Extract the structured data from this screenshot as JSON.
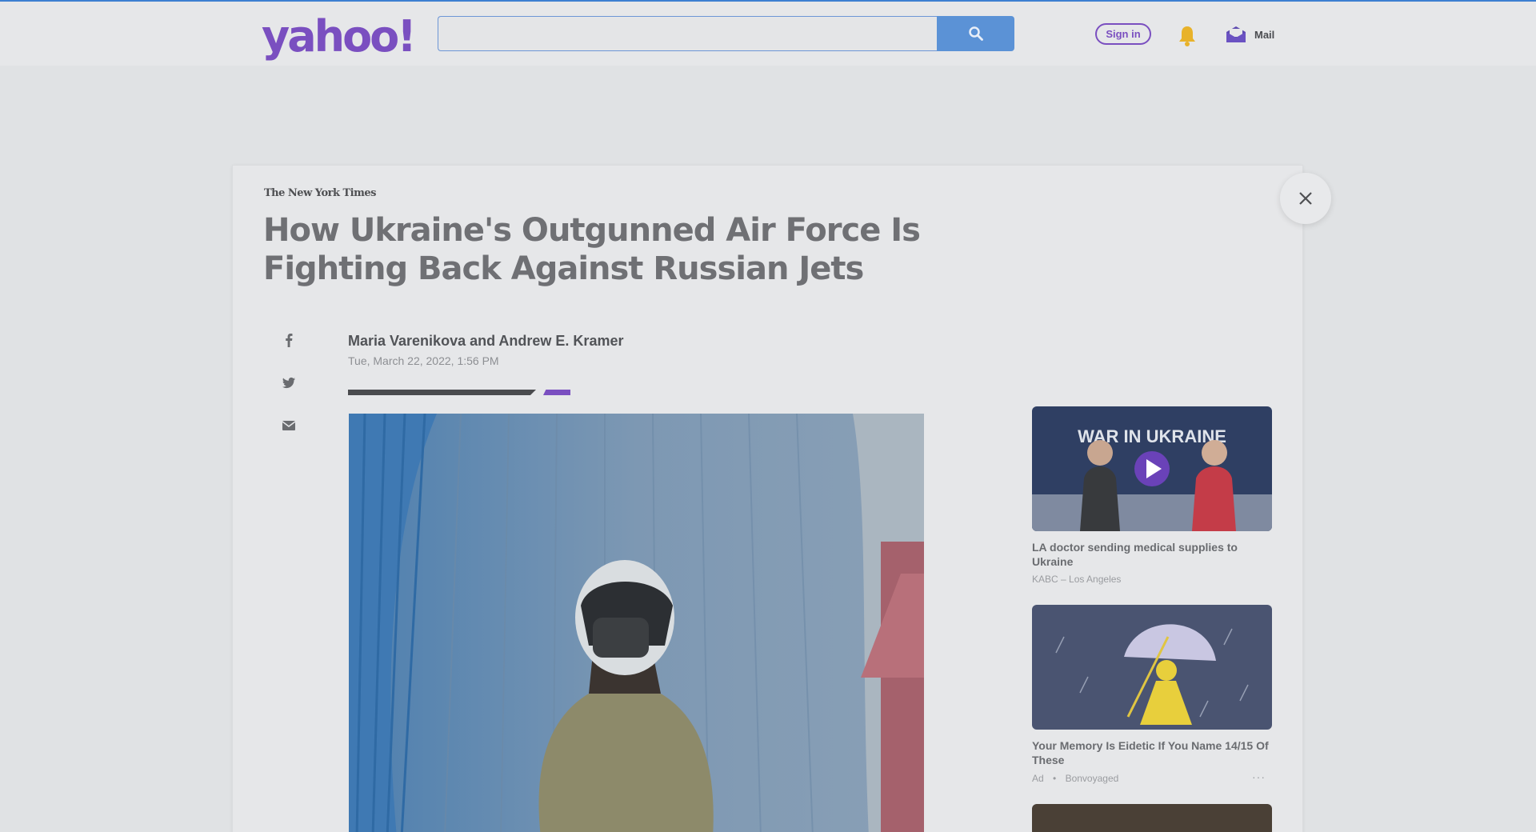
{
  "header": {
    "logo": "yahoo!",
    "search": {
      "value": "",
      "placeholder": ""
    },
    "signin_label": "Sign in",
    "mail_label": "Mail"
  },
  "article": {
    "source": "The New York Times",
    "title": "How Ukraine's Outgunned Air Force Is Fighting Back Against Russian Jets",
    "authors": "Maria Varenikova and Andrew E. Kramer",
    "date": "Tue, March 22, 2022, 1:56 PM"
  },
  "share_icons": [
    "facebook-icon",
    "twitter-icon",
    "mail-icon"
  ],
  "sidebar": {
    "items": [
      {
        "title": "LA doctor sending medical supplies to Ukraine",
        "source": "KABC – Los Angeles",
        "thumb_text": "WAR IN UKRAINE",
        "has_video": true
      },
      {
        "title": "Your Memory Is Eidetic If You Name 14/15 Of These",
        "ad_label": "Ad",
        "separator": "•",
        "source": "Bonvoyaged",
        "more": "···"
      }
    ]
  },
  "colors": {
    "brand": "#7a4fc0",
    "search_button": "#5b92d6",
    "bell": "#e8b22a",
    "page_bg": "#e0e2e4"
  }
}
